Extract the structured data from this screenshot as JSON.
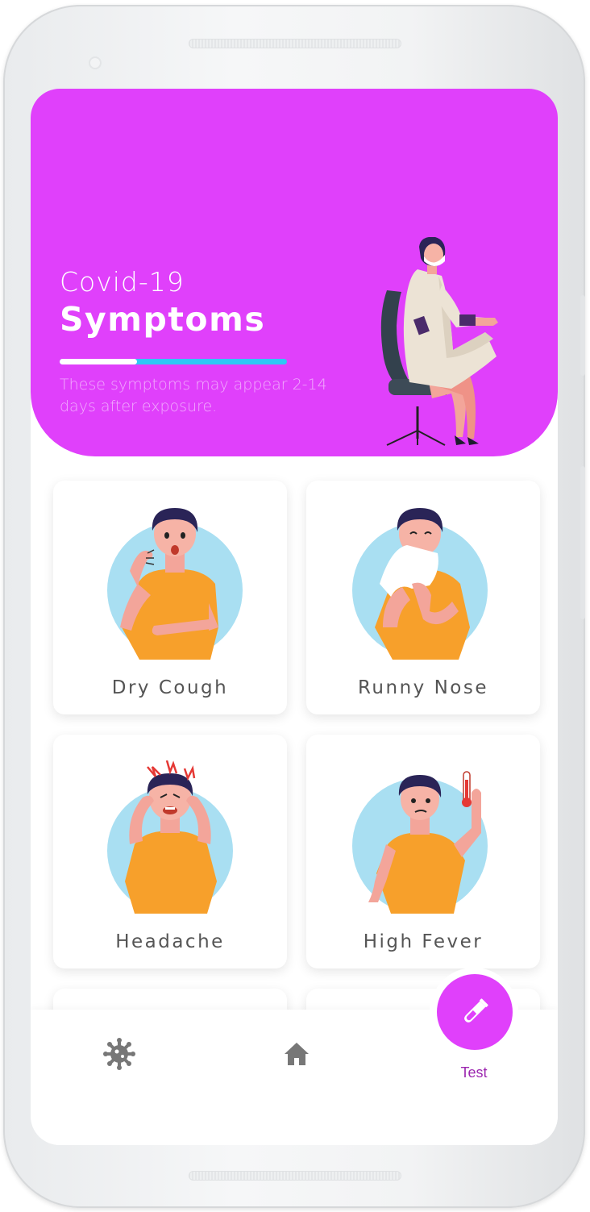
{
  "header": {
    "subtitle": "Covid-19",
    "title": "Symptoms",
    "progress": 0.34,
    "description": "These symptoms may appear 2-14 days after exposure."
  },
  "symptoms": [
    {
      "label": "Dry Cough",
      "icon": "coughing-man-icon"
    },
    {
      "label": "Runny Nose",
      "icon": "sneezing-man-icon"
    },
    {
      "label": "Headache",
      "icon": "headache-man-icon"
    },
    {
      "label": "High Fever",
      "icon": "fever-man-icon"
    }
  ],
  "nav": {
    "items": [
      {
        "icon": "virus-icon"
      },
      {
        "icon": "home-icon"
      }
    ],
    "test_label": "Test",
    "test_icon": "test-tube-icon"
  },
  "colors": {
    "accent": "#e040fb",
    "progress_track": "#2ec7f5",
    "circle_bg": "#a9dff2",
    "shirt": "#f7a02b",
    "test_label": "#9c27b0"
  }
}
